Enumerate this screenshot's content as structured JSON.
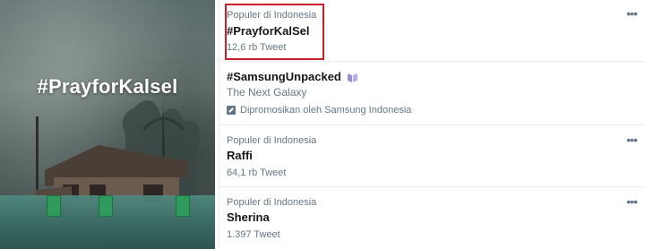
{
  "photo": {
    "hashtag_text": "#PrayforKalsel"
  },
  "trends": [
    {
      "context": "Populer di Indonesia",
      "name": "#PrayforKalSel",
      "count": "12,6 rb Tweet",
      "highlighted": true
    },
    {
      "name": "#SamsungUnpacked",
      "emoji_icon": "galaxy-book-emoji-icon",
      "description": "The Next Galaxy",
      "promoted": "Dipromosikan oleh Samsung Indonesia"
    },
    {
      "context": "Populer di Indonesia",
      "name": "Raffi",
      "count": "64,1 rb Tweet"
    },
    {
      "context": "Populer di Indonesia",
      "name": "Sherina",
      "count": "1.397 Tweet"
    }
  ],
  "colors": {
    "highlight_border": "#c8202a",
    "secondary_text": "#657786",
    "primary_text": "#14171a"
  }
}
